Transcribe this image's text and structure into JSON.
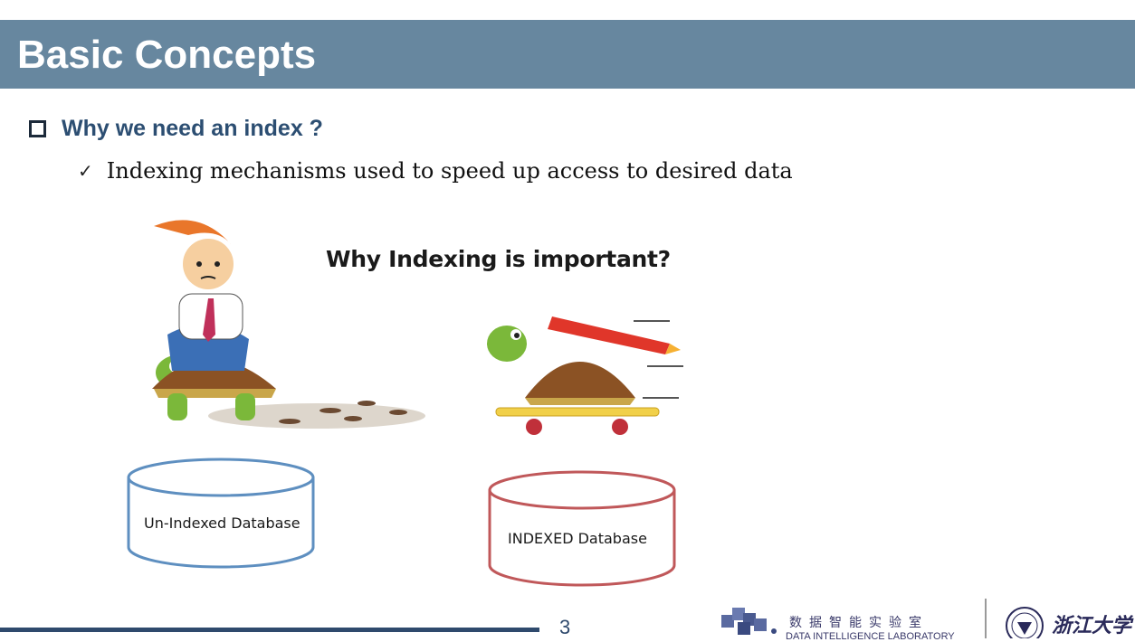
{
  "slide": {
    "title": "Basic Concepts",
    "bullet1": "Why we need an index ?",
    "bullet2": "Indexing mechanisms used to speed up access to desired data",
    "page_number": "3"
  },
  "illustration": {
    "title": "Why Indexing is important?",
    "left_db_label": "Un-Indexed Database",
    "right_db_label": "INDEXED Database",
    "left_db_color": "#5e8fc0",
    "right_db_color": "#c0585a"
  },
  "footer": {
    "lab_name_cn": "数据智能实验室",
    "lab_name_en": "DATA INTELLIGENCE LABORATORY",
    "university_cn": "浙江大学"
  },
  "colors": {
    "title_bar": "#67879f",
    "bullet_heading": "#2c4e72",
    "footer_line": "#2f4a6d"
  }
}
